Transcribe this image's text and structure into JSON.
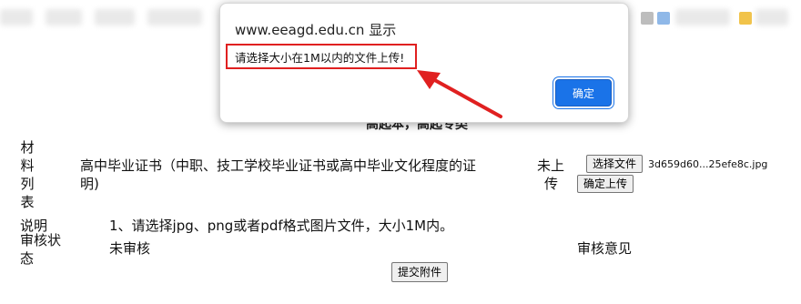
{
  "dialog": {
    "title": "www.eeagd.edu.cn 显示",
    "message": "请选择大小在1M以内的文件上传!",
    "ok_label": "确定",
    "accent": "#1a73e8",
    "highlight_color": "#e02020"
  },
  "page": {
    "heading": "高起本，高起专类",
    "materials_label_chars": [
      "材",
      "料",
      "列",
      "表"
    ],
    "material_name_line1": "高中毕业证书（中职、技工学校毕业证书或高中毕业文化程度的证",
    "material_name_line2": "明)",
    "upload_status_line1": "未上",
    "upload_status_line2": "传",
    "choose_file_label": "选择文件",
    "selected_file": "3d659d60...25efe8c.jpg",
    "confirm_upload_label": "确定上传",
    "note_label": "说明",
    "note_text": "1、请选择jpg、png或者pdf格式图片文件，大小1M内。",
    "review_status_label_line1": "审核状",
    "review_status_label_line2": "态",
    "review_status_value": "未审核",
    "review_opinion_label": "审核意见",
    "submit_label": "提交附件"
  },
  "icons": [
    "bookmark-icon",
    "arrow-icon"
  ]
}
